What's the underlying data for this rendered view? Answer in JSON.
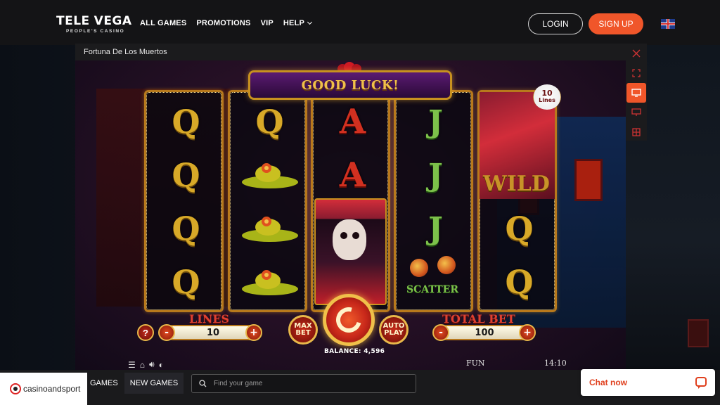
{
  "brand": {
    "name_left": "TELE",
    "name_right": "VEGA",
    "tagline": "PEOPLE'S CASINO"
  },
  "nav": {
    "links": [
      "ALL GAMES",
      "PROMOTIONS",
      "VIP",
      "HELP"
    ]
  },
  "auth": {
    "login_label": "LOGIN",
    "signup_label": "SIGN UP"
  },
  "language": {
    "icon": "uk-flag-icon"
  },
  "game_window": {
    "title": "Fortuna De Los Muertos",
    "tools": [
      "close-icon",
      "fullscreen-icon",
      "desktop-icon",
      "theater-icon",
      "grid-icon"
    ]
  },
  "slot": {
    "banner": "GOOD LUCK!",
    "lines_badge_number": "10",
    "lines_badge_label": "Lines",
    "reels": [
      [
        "Q",
        "Q",
        "Q",
        "Q"
      ],
      [
        "Q",
        "hat",
        "hat",
        "hat"
      ],
      [
        "A",
        "A",
        "character",
        "character"
      ],
      [
        "J",
        "J",
        "J",
        "scatter"
      ],
      [
        "wild",
        "wild",
        "Q",
        "Q"
      ]
    ],
    "wild_label": "WILD",
    "scatter_label": "SCATTER",
    "lines_label": "LINES",
    "lines_value": "10",
    "total_bet_label": "TOTAL BET",
    "total_bet_value": "100",
    "help_label": "?",
    "minus": "-",
    "plus": "+",
    "max_bet_label": "MAX BET",
    "auto_play_label": "AUTO PLAY",
    "balance_label": "BALANCE: 4,596",
    "mode": "FUN",
    "clock": "14:10"
  },
  "bottom": {
    "partner": "casinoandsport",
    "games_tab": "GAMES",
    "new_games_tab": "NEW GAMES",
    "search_placeholder": "Find your game",
    "chat_label": "Chat now"
  },
  "colors": {
    "accent": "#f0562a",
    "gold": "#c8911f",
    "green": "#7cc14a",
    "red": "#d23020"
  }
}
